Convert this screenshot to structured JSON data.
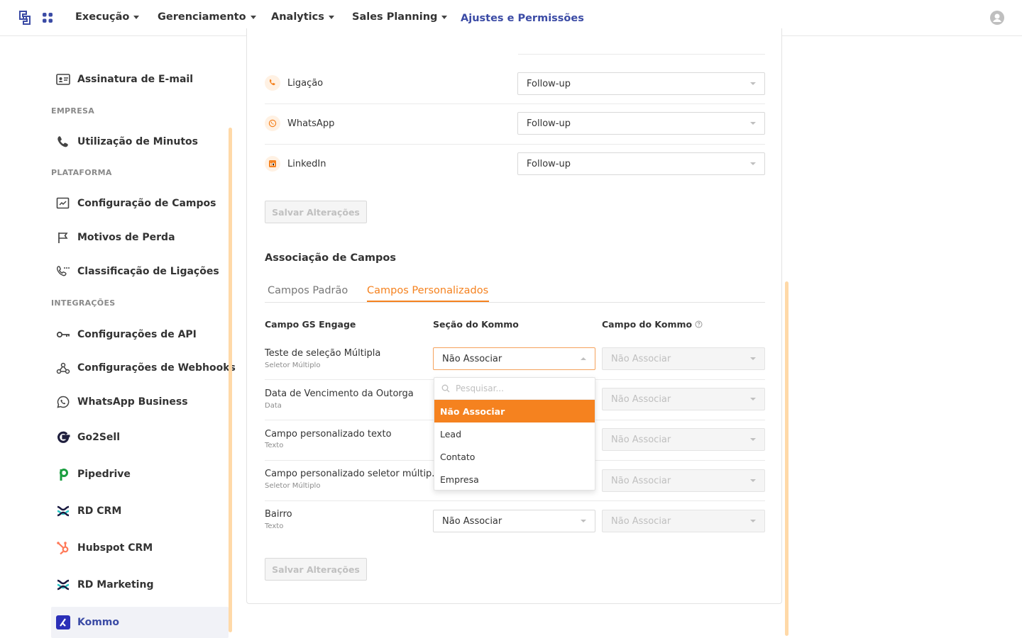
{
  "topbar": {
    "nav": [
      "Execução",
      "Gerenciamento",
      "Analytics",
      "Sales Planning"
    ],
    "active": "Ajustes e Permissões"
  },
  "sidebar": {
    "email_signature": "Assinatura de E-mail",
    "section_empresa": "EMPRESA",
    "minutes": "Utilização de Minutos",
    "section_plataforma": "PLATAFORMA",
    "fields_config": "Configuração de Campos",
    "loss_reasons": "Motivos de Perda",
    "call_classification": "Classificação de Ligações",
    "section_integracoes": "INTEGRAÇÕES",
    "api_config": "Configurações de API",
    "webhooks_config": "Configurações de Webhooks",
    "whatsapp_business": "WhatsApp Business",
    "go2sell": "Go2Sell",
    "pipedrive": "Pipedrive",
    "rd_crm": "RD CRM",
    "hubspot": "Hubspot CRM",
    "rd_marketing": "RD Marketing",
    "kommo": "Kommo"
  },
  "channels": [
    {
      "label": "Ligação",
      "value": "Follow-up"
    },
    {
      "label": "WhatsApp",
      "value": "Follow-up"
    },
    {
      "label": "LinkedIn",
      "value": "Follow-up"
    }
  ],
  "save_button": "Salvar Alterações",
  "association": {
    "title": "Associação de Campos",
    "tab_default": "Campos Padrão",
    "tab_custom": "Campos Personalizados",
    "col_gs": "Campo GS Engage",
    "col_section": "Seção do Kommo",
    "col_field": "Campo do Kommo",
    "rows": [
      {
        "name": "Teste de seleção Múltipla",
        "type": "Seletor Múltiplo",
        "section": "Não Associar",
        "field": "Não Associar"
      },
      {
        "name": "Data de Vencimento da Outorga",
        "type": "Data",
        "section": "",
        "field": "Não Associar"
      },
      {
        "name": "Campo personalizado texto",
        "type": "Texto",
        "section": "",
        "field": "Não Associar"
      },
      {
        "name": "Campo personalizado seletor múltip...",
        "type": "Seletor Múltiplo",
        "section": "",
        "field": "Não Associar"
      },
      {
        "name": "Bairro",
        "type": "Texto",
        "section": "Não Associar",
        "field": "Não Associar"
      }
    ]
  },
  "dropdown": {
    "placeholder": "Pesquisar...",
    "options": [
      "Não Associar",
      "Lead",
      "Contato",
      "Empresa"
    ]
  },
  "colors": {
    "accent": "#f5821f",
    "brand": "#3b4ba5"
  }
}
